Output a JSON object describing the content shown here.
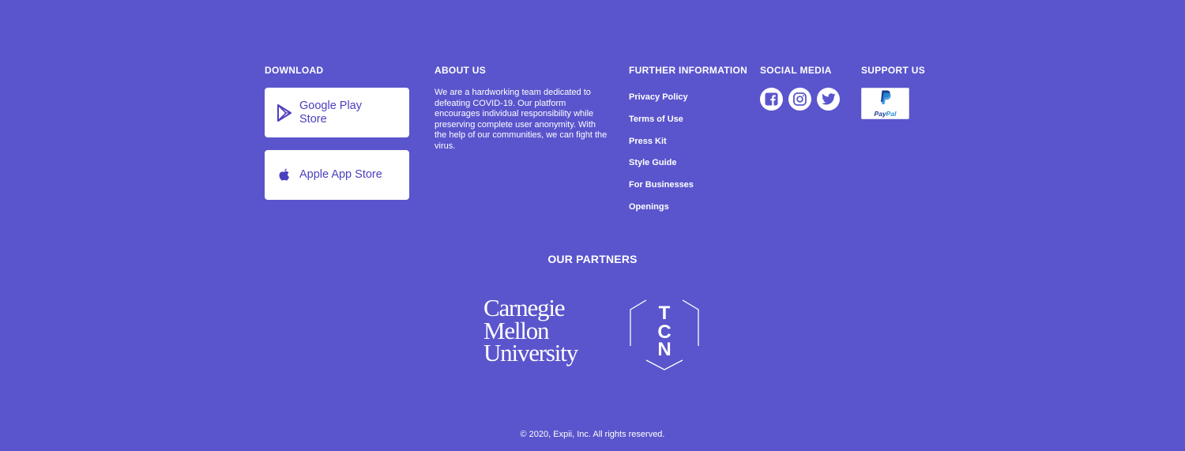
{
  "download": {
    "heading": "DOWNLOAD",
    "buttons": [
      {
        "label": "Google Play Store",
        "icon": "google-play-icon"
      },
      {
        "label": "Apple App Store",
        "icon": "apple-icon"
      }
    ]
  },
  "about": {
    "heading": "ABOUT US",
    "text": "We are a hardworking team dedicated to defeating COVID-19. Our platform encourages individual responsibility while preserving complete user anonymity. With the help of our communities, we can fight the virus."
  },
  "further_info": {
    "heading": "FURTHER INFORMATION",
    "links": [
      "Privacy Policy",
      "Terms of Use",
      "Press Kit",
      "Style Guide",
      "For Businesses",
      "Openings"
    ]
  },
  "social": {
    "heading": "SOCIAL MEDIA",
    "icons": [
      "facebook-icon",
      "instagram-icon",
      "twitter-icon"
    ]
  },
  "support": {
    "heading": "SUPPORT US",
    "paypal_label_a": "Pay",
    "paypal_label_b": "Pal"
  },
  "partners": {
    "heading": "OUR PARTNERS",
    "cmu": [
      "Carnegie",
      "Mellon",
      "University"
    ],
    "tcn": [
      "T",
      "C",
      "N"
    ]
  },
  "footer": {
    "copyright": "© 2020, Expii, Inc. All rights reserved."
  },
  "colors": {
    "background": "#5a55cc",
    "button_text": "#4b3fbf",
    "text": "#ffffff"
  }
}
